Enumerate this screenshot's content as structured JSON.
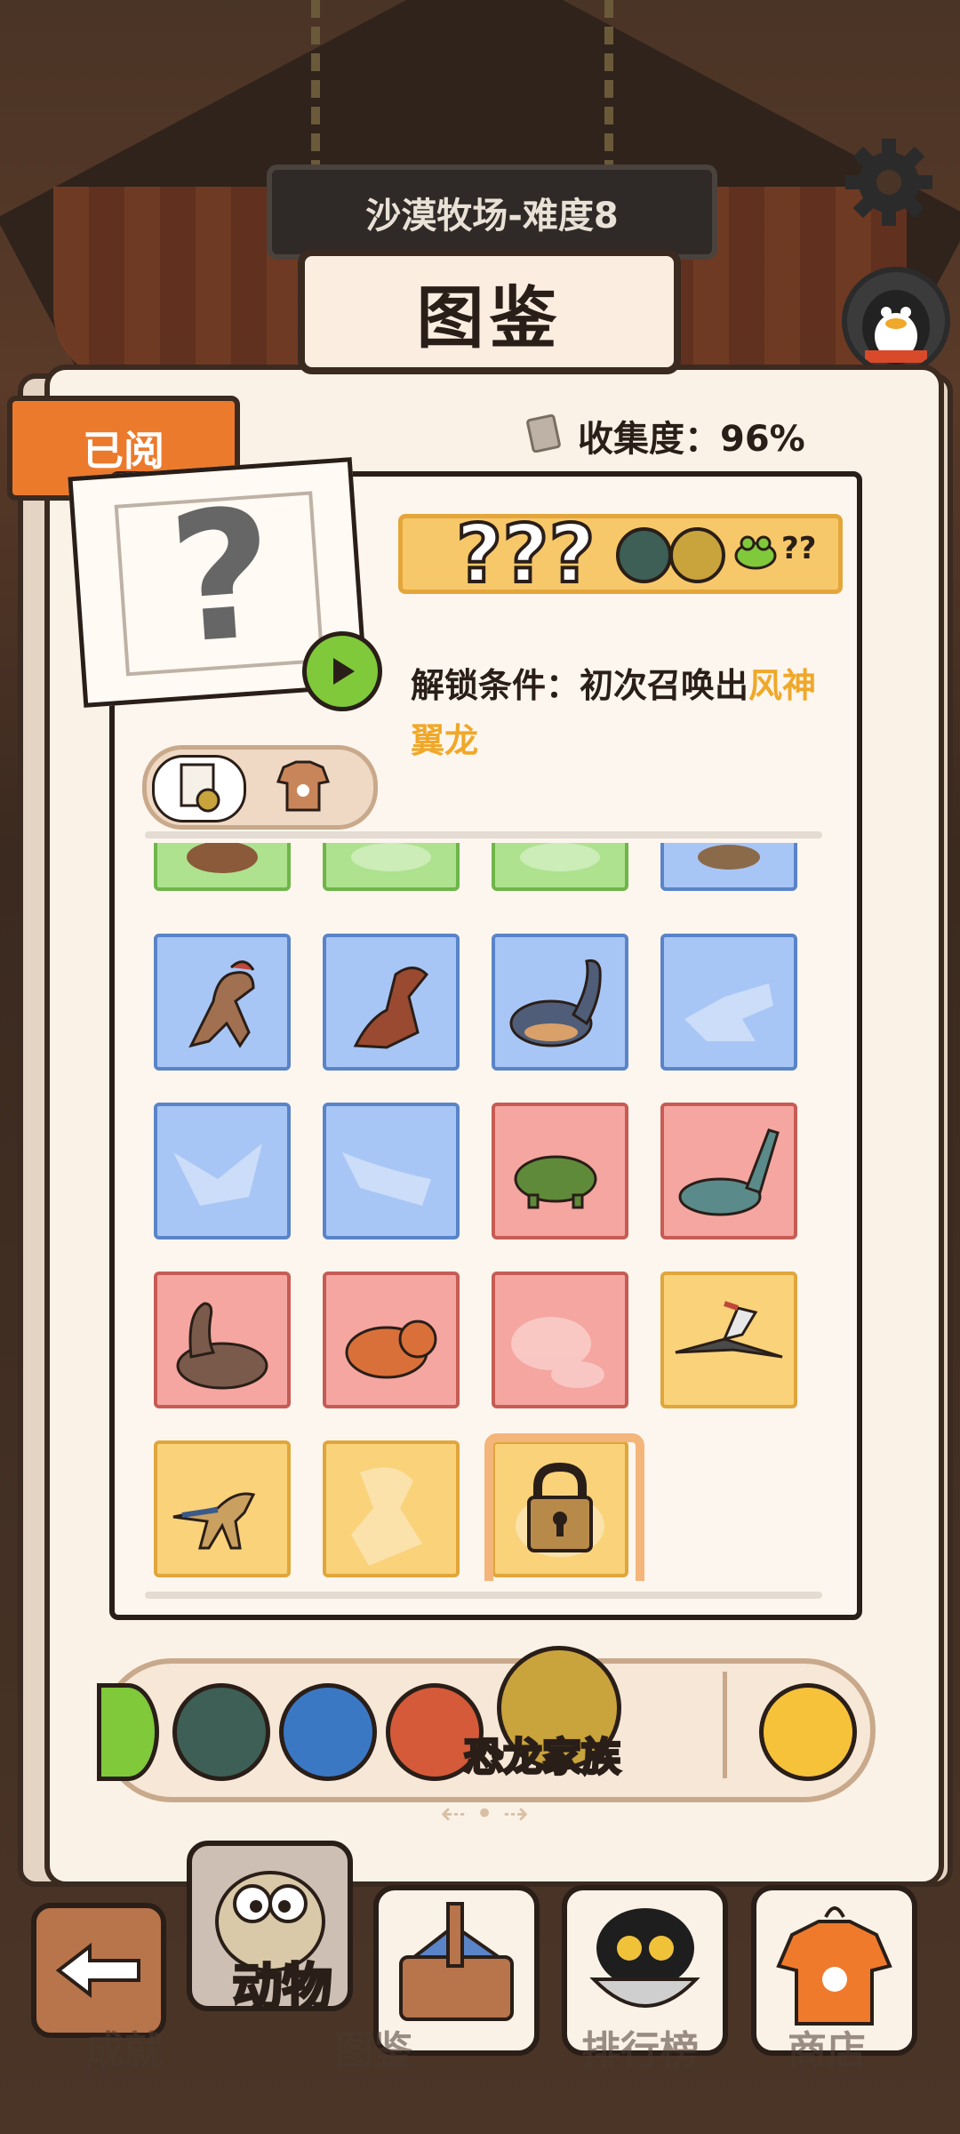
{
  "header": {
    "level_title": "沙漠牧场-难度8",
    "book_title": "图鉴"
  },
  "tabs": {
    "read_tab": "已阅"
  },
  "collection": {
    "label": "收集度：96%"
  },
  "featured": {
    "name": "???",
    "count": "??",
    "unlock_prefix": "解锁条件：",
    "unlock_text": "初次召唤出",
    "unlock_highlight": "风神翼龙"
  },
  "grid": {
    "rows": [
      [
        "green",
        "green",
        "green",
        "blue"
      ],
      [
        "blue",
        "blue",
        "blue",
        "blue"
      ],
      [
        "blue",
        "blue",
        "red",
        "red"
      ],
      [
        "red",
        "red",
        "red",
        "yellow"
      ],
      [
        "yellow",
        "yellow",
        "yellow-locked"
      ]
    ]
  },
  "category": {
    "selected_label": "恐龙家族"
  },
  "pager": {
    "indicator": "⇠ • ⇢"
  },
  "nav": {
    "animal": "动物",
    "achievement": "成就",
    "handbook": "图鉴",
    "ranking": "排行榜",
    "shop": "商店"
  },
  "colors": {
    "accent_orange": "#ec7a2c",
    "highlight_yellow": "#f0a82a",
    "play_green": "#7fc93a"
  }
}
